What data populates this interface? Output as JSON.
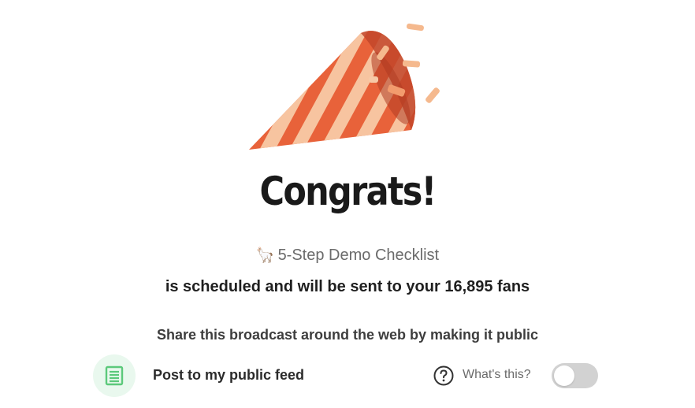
{
  "celebration": {
    "title": "Congrats!",
    "illustration": "party-popper-illustration"
  },
  "broadcast": {
    "emoji": "🦙",
    "name": "5-Step Demo Checklist",
    "status": "is scheduled and will be sent to your 16,895 fans"
  },
  "share": {
    "prompt": "Share this broadcast around the web by making it public",
    "feed_label": "Post to my public feed",
    "feed_icon": "document-icon",
    "help_icon": "question-circle-icon",
    "help_label": "What's this?",
    "toggle_on": false
  },
  "colors": {
    "accent_green": "#5cc97b",
    "accent_green_bg": "#e9f8ee",
    "popper_orange": "#e8623a",
    "popper_light": "#f8caa6",
    "toggle_off": "#d2d2d2"
  }
}
